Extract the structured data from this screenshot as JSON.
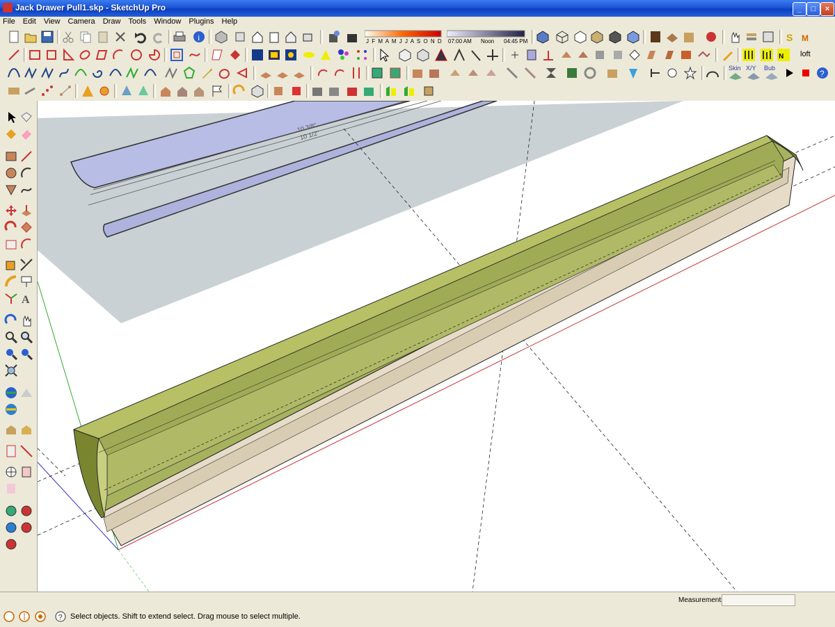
{
  "window": {
    "title": "Jack Drawer Pull1.skp - SketchUp Pro"
  },
  "menu": [
    "File",
    "Edit",
    "View",
    "Camera",
    "Draw",
    "Tools",
    "Window",
    "Plugins",
    "Help"
  ],
  "shadow_bar": {
    "months": "J F M A M J J A S O N D",
    "time_start": "07:00 AM",
    "time_mid": "Noon",
    "time_end": "04:45 PM"
  },
  "plugins": {
    "skin": "Skin",
    "xy": "X/Y",
    "bub": "Bub",
    "loft": "loft"
  },
  "drawing": {
    "dim1": "10 3/8\"",
    "dim2": "10 1/2\""
  },
  "status": {
    "hint": "Select objects. Shift to extend select. Drag mouse to select multiple.",
    "measurements_label": "Measurements",
    "measurements_value": ""
  },
  "colors": {
    "model_green": "#a7b25e",
    "model_dark": "#7a8530",
    "underside": "#e6dcc8",
    "image_plane": "#c9d1d4",
    "titlebar": "#0a3fc2"
  }
}
